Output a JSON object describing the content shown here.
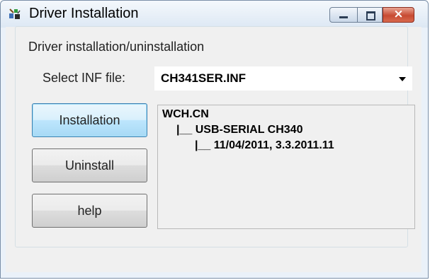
{
  "window": {
    "title": "Driver Installation",
    "icon": "driver-setup-icon"
  },
  "caption_buttons": {
    "minimize_icon": "minimize-icon",
    "maximize_icon": "maximize-icon",
    "close_glyph": "×"
  },
  "group": {
    "label": "Driver installation/uninstallation"
  },
  "inf_select": {
    "label": "Select INF file:",
    "value": "CH341SER.INF"
  },
  "buttons": {
    "install": "Installation",
    "uninstall": "Uninstall",
    "help": "help"
  },
  "driver_info": {
    "lines": [
      "WCH.CN",
      "|__ USB-SERIAL CH340",
      "|__ 11/04/2011, 3.3.2011.11"
    ]
  },
  "colors": {
    "close_button": "#c74a32",
    "focused_button": "#3c7fb1",
    "dialog_background": "#f0f0f0"
  }
}
